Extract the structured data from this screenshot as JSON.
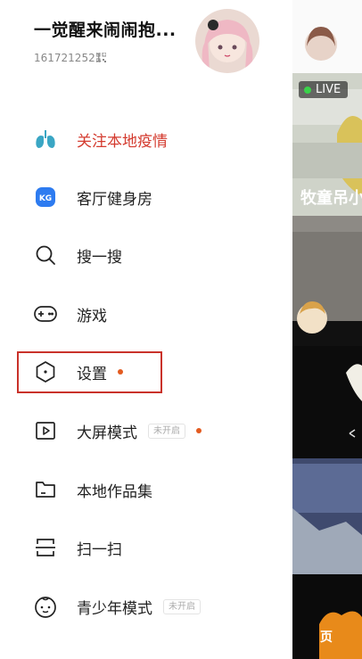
{
  "profile": {
    "username": "一觉醒来闹闹抱...",
    "uid": "1617212521"
  },
  "menu": [
    {
      "id": "follow-local-epidemic",
      "label": "关注本地疫情",
      "icon": "lungs-icon",
      "color": "#d43b2f"
    },
    {
      "id": "living-room-gym",
      "label": "客厅健身房",
      "icon": "kg-icon"
    },
    {
      "id": "search",
      "label": "搜一搜",
      "icon": "search-icon"
    },
    {
      "id": "games",
      "label": "游戏",
      "icon": "gamepad-icon"
    },
    {
      "id": "settings",
      "label": "设置",
      "icon": "hexagon-settings-icon",
      "dot": true
    },
    {
      "id": "big-screen",
      "label": "大屏模式",
      "icon": "play-screen-icon",
      "badge": "未开启",
      "dot": true
    },
    {
      "id": "local-works",
      "label": "本地作品集",
      "icon": "folder-icon"
    },
    {
      "id": "scan",
      "label": "扫一扫",
      "icon": "scan-icon"
    },
    {
      "id": "teen-mode",
      "label": "青少年模式",
      "icon": "child-face-icon",
      "badge": "未开启"
    }
  ],
  "background": {
    "live_label": "LIVE",
    "video_title": "牧童吊小",
    "page_label": "页"
  },
  "colors": {
    "accent_red": "#d43b2f",
    "dot_orange": "#e35b20",
    "highlight_border": "#c9322a"
  }
}
